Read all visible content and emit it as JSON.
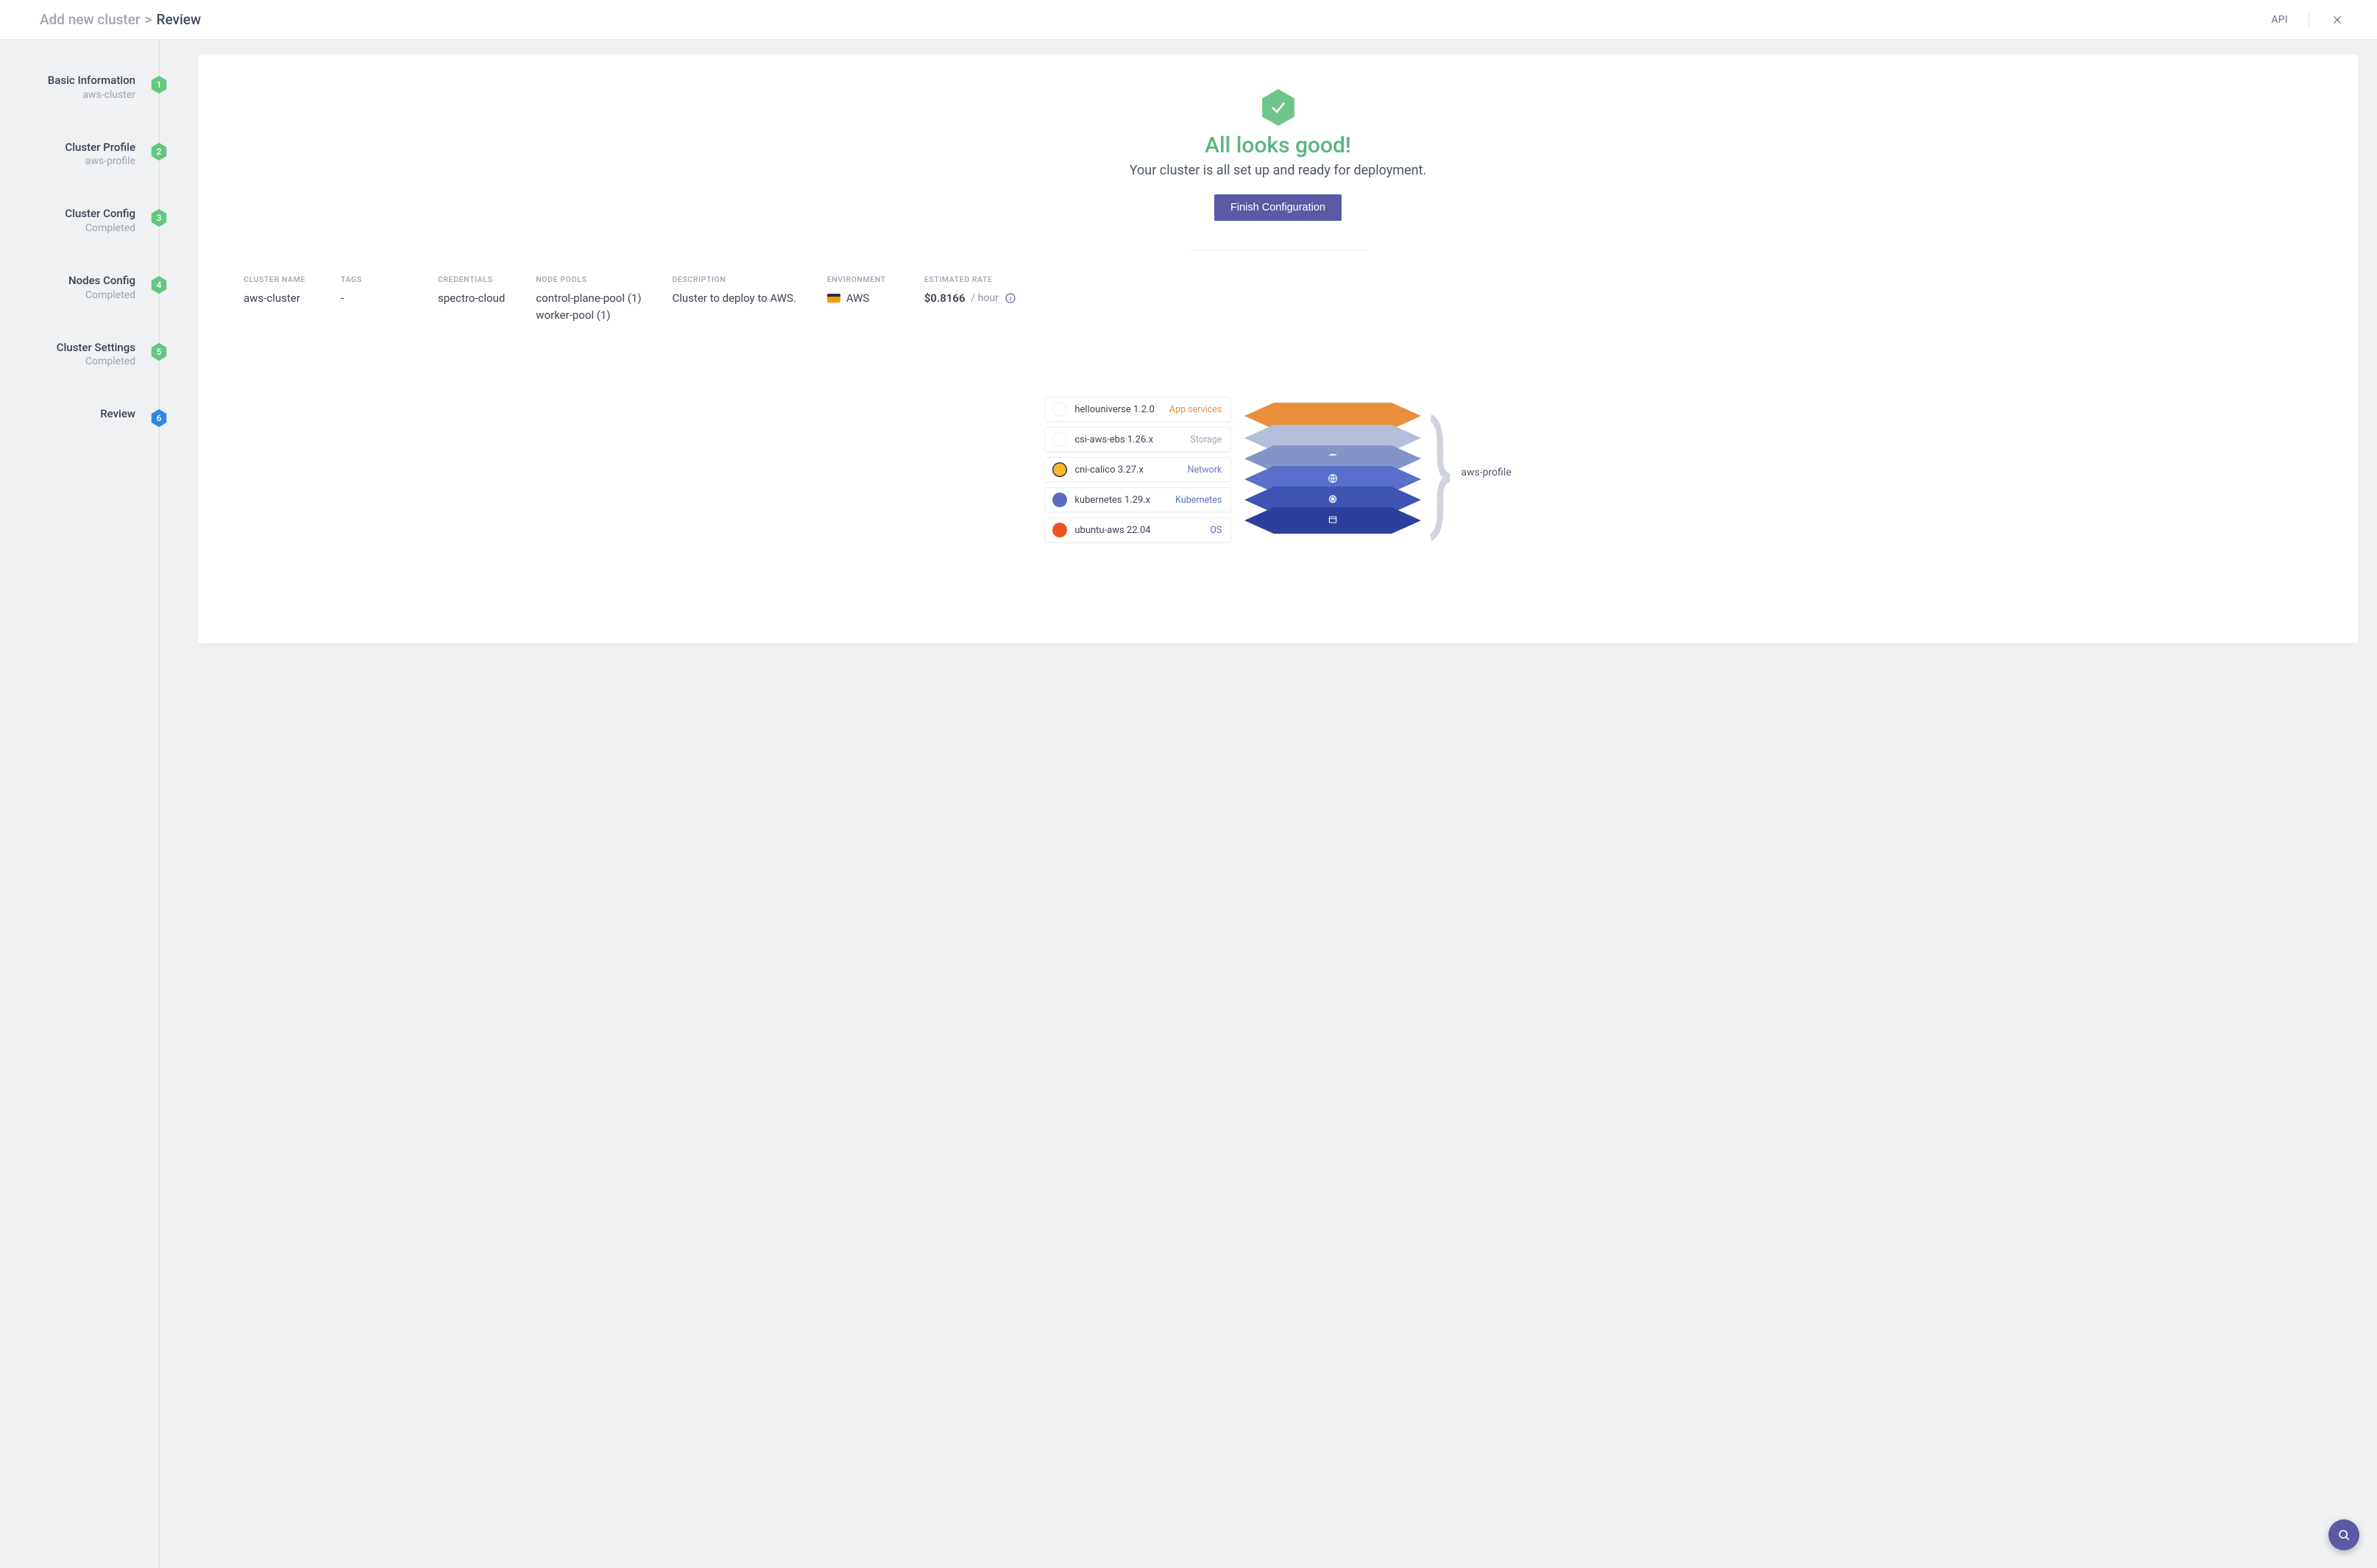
{
  "header": {
    "breadcrumb_root": "Add new cluster",
    "breadcrumb_sep": ">",
    "breadcrumb_leaf": "Review",
    "api_link": "API"
  },
  "steps": [
    {
      "title": "Basic Information",
      "sub": "aws-cluster",
      "num": "1",
      "state": "done"
    },
    {
      "title": "Cluster Profile",
      "sub": "aws-profile",
      "num": "2",
      "state": "done"
    },
    {
      "title": "Cluster Config",
      "sub": "Completed",
      "num": "3",
      "state": "done"
    },
    {
      "title": "Nodes Config",
      "sub": "Completed",
      "num": "4",
      "state": "done"
    },
    {
      "title": "Cluster Settings",
      "sub": "Completed",
      "num": "5",
      "state": "done"
    },
    {
      "title": "Review",
      "sub": "",
      "num": "6",
      "state": "current"
    }
  ],
  "hero": {
    "title": "All looks good!",
    "subtitle": "Your cluster is all set up and ready for deployment.",
    "cta": "Finish Configuration"
  },
  "summary": {
    "cluster_name_label": "CLUSTER NAME",
    "cluster_name": "aws-cluster",
    "tags_label": "TAGS",
    "tags": "-",
    "credentials_label": "CREDENTIALS",
    "credentials": "spectro-cloud",
    "node_pools_label": "NODE POOLS",
    "node_pools": [
      "control-plane-pool (1)",
      "worker-pool (1)"
    ],
    "description_label": "DESCRIPTION",
    "description": "Cluster to deploy to AWS.",
    "environment_label": "ENVIRONMENT",
    "environment": "AWS",
    "rate_label": "ESTIMATED RATE",
    "rate_value": "$0.8166",
    "rate_unit": "/ hour"
  },
  "stack": {
    "profile_name": "aws-profile",
    "layers": [
      {
        "name": "hellouniverse 1.2.0",
        "type": "App services",
        "type_class": "c-app",
        "icon": "folder"
      },
      {
        "name": "csi-aws-ebs 1.26.x",
        "type": "Storage",
        "type_class": "c-storage",
        "icon": "aws"
      },
      {
        "name": "cni-calico 3.27.x",
        "type": "Network",
        "type_class": "c-net",
        "icon": "calico"
      },
      {
        "name": "kubernetes 1.29.x",
        "type": "Kubernetes",
        "type_class": "c-k8s",
        "icon": "k8s"
      },
      {
        "name": "ubuntu-aws 22.04",
        "type": "OS",
        "type_class": "c-os",
        "icon": "ubuntu"
      }
    ]
  },
  "colors": {
    "step_done": "#63c77f",
    "step_current": "#2f86e5"
  }
}
